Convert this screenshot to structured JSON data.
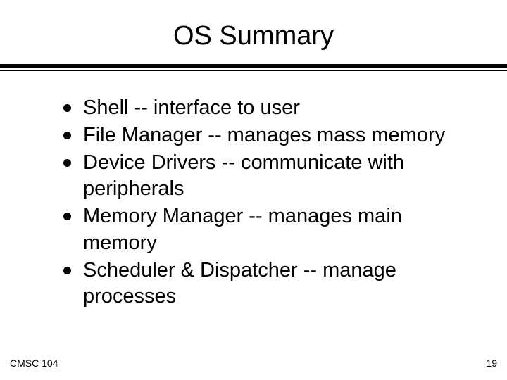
{
  "title": "OS Summary",
  "bullets": [
    "Shell -- interface to user",
    "File Manager -- manages mass memory",
    "Device Drivers -- communicate with peripherals",
    "Memory Manager -- manages main memory",
    "Scheduler & Dispatcher -- manage processes"
  ],
  "footer": {
    "left": "CMSC 104",
    "right": "19"
  }
}
